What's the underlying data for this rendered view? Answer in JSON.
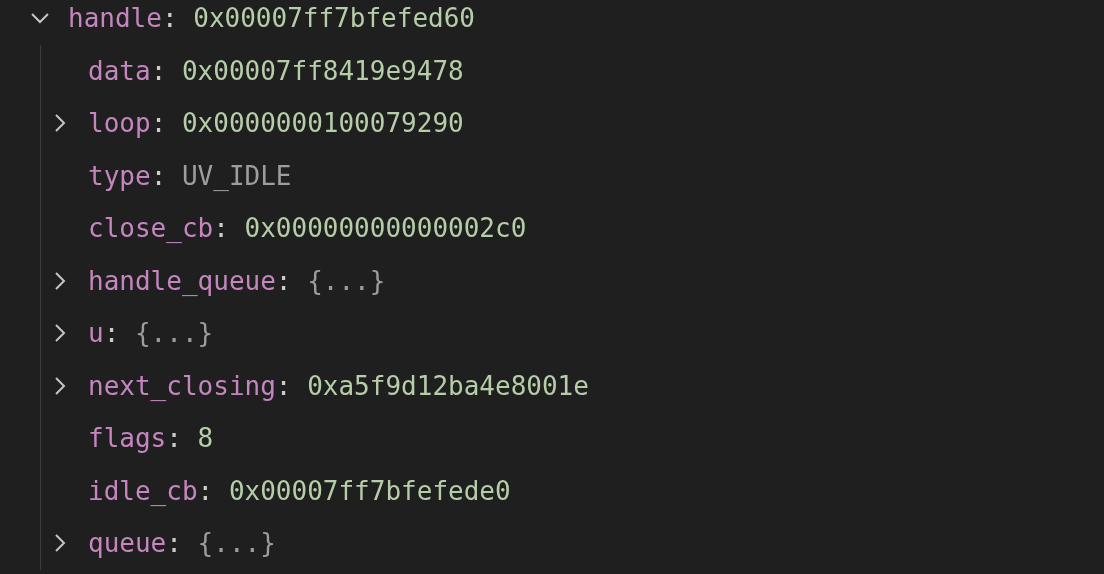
{
  "variables": [
    {
      "name": "handle",
      "separator": ":",
      "value": "0x00007ff7bfefed60",
      "kind": "number",
      "expanded": true,
      "children": [
        {
          "name": "data",
          "separator": ":",
          "value": "0x00007ff8419e9478",
          "kind": "number"
        },
        {
          "name": "loop",
          "separator": ":",
          "value": "0x0000000100079290",
          "kind": "number",
          "expanded": false
        },
        {
          "name": "type",
          "separator": ":",
          "value": "UV_IDLE",
          "kind": "text"
        },
        {
          "name": "close_cb",
          "separator": ":",
          "value": "0x00000000000002c0",
          "kind": "number"
        },
        {
          "name": "handle_queue",
          "separator": ":",
          "value": "{...}",
          "kind": "text",
          "expanded": false
        },
        {
          "name": "u",
          "separator": ":",
          "value": "{...}",
          "kind": "text",
          "expanded": false
        },
        {
          "name": "next_closing",
          "separator": ":",
          "value": "0xa5f9d12ba4e8001e",
          "kind": "number",
          "expanded": false
        },
        {
          "name": "flags",
          "separator": ":",
          "value": "8",
          "kind": "number"
        },
        {
          "name": "idle_cb",
          "separator": ":",
          "value": "0x00007ff7bfefede0",
          "kind": "number"
        },
        {
          "name": "queue",
          "separator": ":",
          "value": "{...}",
          "kind": "text",
          "expanded": false
        }
      ]
    }
  ]
}
